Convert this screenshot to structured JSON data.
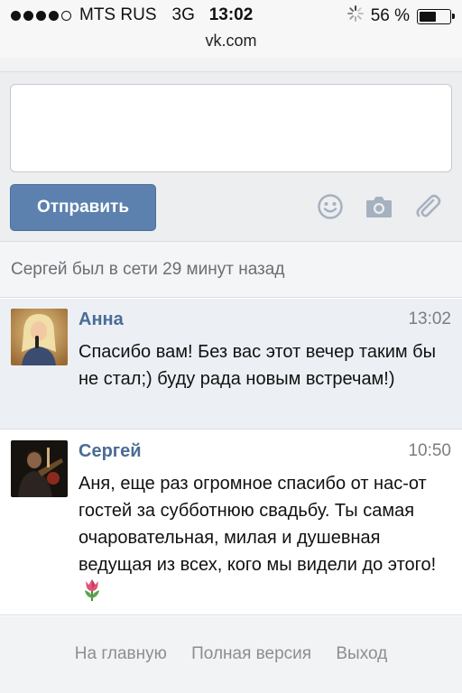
{
  "status_bar": {
    "carrier": "MTS RUS",
    "network": "3G",
    "time": "13:02",
    "battery": "56 %",
    "battery_level": 0.56,
    "signal_bars_filled": 4,
    "signal_bars_total": 5
  },
  "browser": {
    "url": "vk.com"
  },
  "compose": {
    "input_value": "",
    "send_label": "Отправить",
    "icons": [
      "smile-icon",
      "camera-icon",
      "paperclip-icon"
    ]
  },
  "conversation": {
    "online_status": "Сергей был в сети 29 минут назад",
    "messages": [
      {
        "author": "Анна",
        "time": "13:02",
        "text": "Спасибо вам! Без вас этот вечер таким бы не стал;) буду рада новым встречам!)",
        "unread": true
      },
      {
        "author": "Сергей",
        "time": "10:50",
        "text": "Аня, еще раз огромное спасибо от нас-от гостей за субботнюю свадьбу. Ты самая очаровательная, милая и душевная ведущая из всех, кого мы видели до этого!",
        "unread": false,
        "emoji": "tulip"
      }
    ]
  },
  "footer": {
    "home": "На главную",
    "full_version": "Полная версия",
    "logout": "Выход"
  },
  "colors": {
    "accent": "#5c81ae",
    "author_name": "#4a6c96",
    "unread_bg": "#ecf0f5"
  }
}
